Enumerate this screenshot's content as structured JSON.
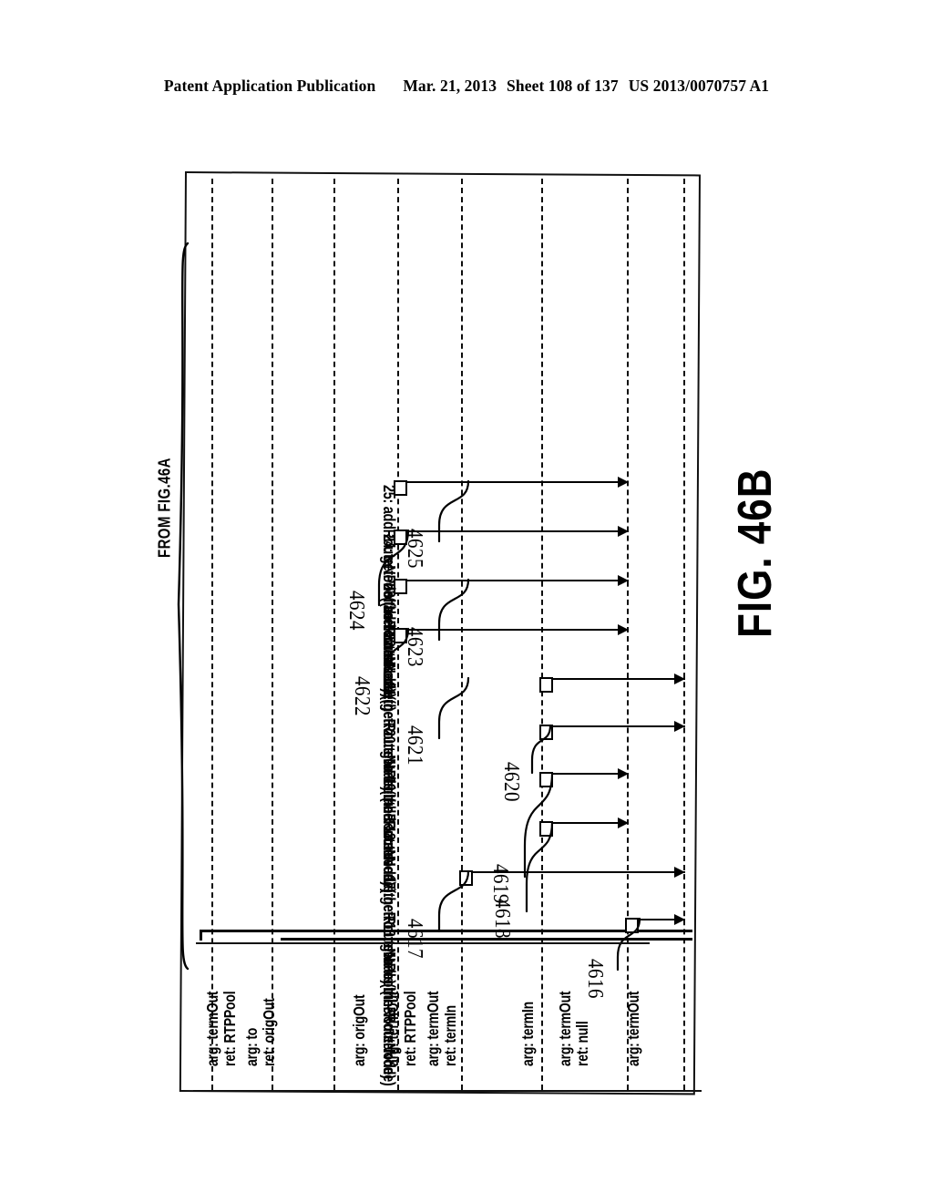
{
  "header": {
    "publication": "Patent Application Publication",
    "date": "Mar. 21, 2013",
    "sheet": "Sheet 108 of 137",
    "doc_number": "US 2013/0070757 A1"
  },
  "figure": {
    "caption": "FIG. 46B",
    "continuation_label": "FROM FIG.46A",
    "type": "uml-sequence-diagram",
    "rotation_degrees": 90,
    "lifeline_count": 8
  },
  "messages": [
    {
      "seq": "16:",
      "label": "16: getPool(theRouteNode)",
      "ref": "4616",
      "from_lifeline": 1,
      "to_lifeline": 2
    },
    {
      "seq": "17:",
      "label": "17: getRouteNode(theRouteNode)",
      "ref": "4617",
      "from_lifeline": 1,
      "to_lifeline": 4
    },
    {
      "seq": "18:",
      "label": "18: reserve:",
      "ref": "4618",
      "from_lifeline": 2,
      "to_lifeline": 3
    },
    {
      "seq": "19:",
      "label": "19: addRouteNode(theRouteNode)",
      "ref": "4619",
      "from_lifeline": 1,
      "to_lifeline": 3
    },
    {
      "seq": "20:",
      "label": "20: getPool(theRouteNode)",
      "ref": "4620",
      "from_lifeline": 1,
      "to_lifeline": 2
    },
    {
      "seq": "21:",
      "label": "21: getRouteNode(theRouteNode)",
      "ref": "4621",
      "from_lifeline": 1,
      "to_lifeline": 4
    },
    {
      "seq": "22:",
      "label": "22: reserve( )",
      "ref": "4622",
      "from_lifeline": 2,
      "to_lifeline": 3
    },
    {
      "seq": "23:",
      "label": "23: addRouteNode(theRouteNode)",
      "ref": "4623",
      "from_lifeline": 1,
      "to_lifeline": 3
    },
    {
      "seq": "24:",
      "label": "24: getPool(theRouteNode)",
      "ref": "4624",
      "from_lifeline": 2,
      "to_lifeline": 3
    },
    {
      "seq": "25:",
      "label": "25: addRouteNode(theRouteNode)",
      "ref": "4625",
      "from_lifeline": 1,
      "to_lifeline": 3
    }
  ],
  "annotations": [
    {
      "lines": [
        "arg:  termOut",
        "ret:  RTPPool"
      ]
    },
    {
      "lines": [
        "arg:  to",
        "ret:  origOut"
      ]
    },
    {
      "lines": [
        "arg:  origOut"
      ]
    },
    {
      "lines": [
        "arg:  termOut",
        "ret:  RTPPool"
      ]
    },
    {
      "lines": [
        "arg:  termOut",
        "ret:  termIn"
      ]
    },
    {
      "lines": [
        "arg:  termIn"
      ]
    },
    {
      "lines": [
        "arg:  termOut",
        "ret:  null"
      ]
    },
    {
      "lines": [
        "arg:  termOut"
      ]
    }
  ],
  "colors": {
    "ink": "#000000",
    "paper": "#ffffff"
  }
}
